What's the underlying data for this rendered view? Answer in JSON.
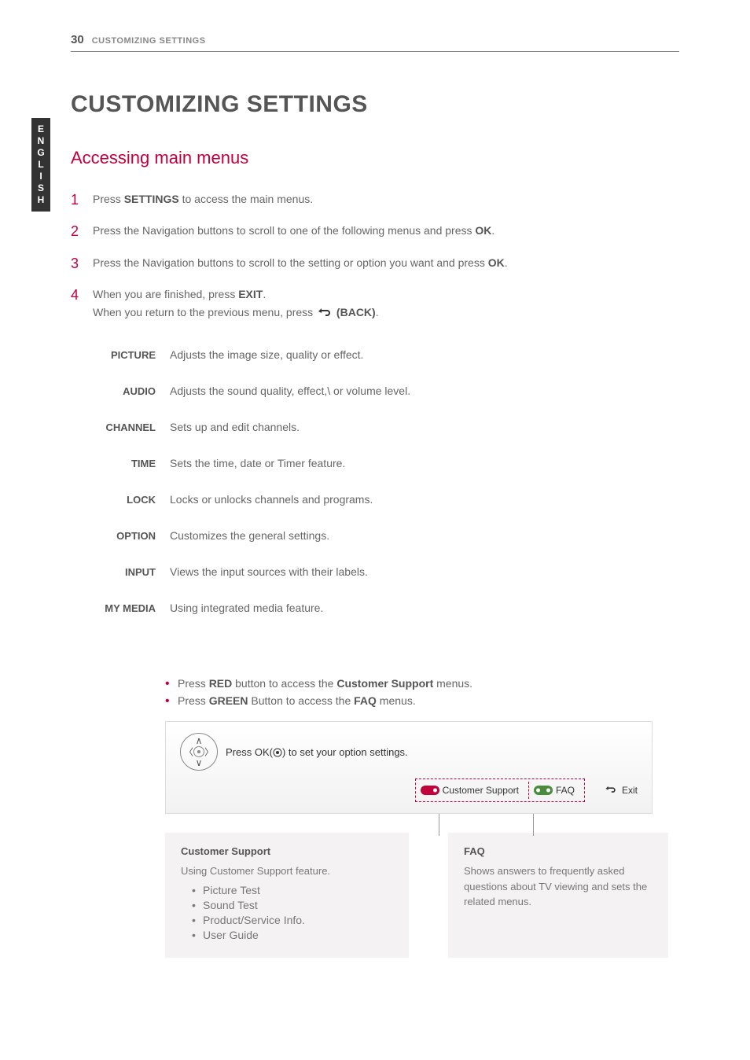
{
  "header": {
    "page_number": "30",
    "running_title": "CUSTOMIZING SETTINGS"
  },
  "language_tab": "ENGLISH",
  "title": "CUSTOMIZING SETTINGS",
  "section_title": "Accessing main menus",
  "steps": {
    "s1_a": "Press ",
    "s1_b": "SETTINGS",
    "s1_c": " to access the main menus.",
    "s2_a": "Press the Navigation buttons to scroll to one of the following menus and press ",
    "s2_b": "OK",
    "s2_c": ".",
    "s3_a": "Press the Navigation buttons to scroll to the setting or option you want and press ",
    "s3_b": "OK",
    "s3_c": ".",
    "s4_a": "When you are finished, press ",
    "s4_b": "EXIT",
    "s4_c": ".",
    "s4_line2_a": "When you return to the previous menu, press ",
    "s4_line2_b": " (BACK)",
    "s4_line2_c": "."
  },
  "menu_items": [
    {
      "label": "PICTURE",
      "desc": "Adjusts the image size, quality or effect."
    },
    {
      "label": "AUDIO",
      "desc": "Adjusts the sound quality, effect,\\ or volume level."
    },
    {
      "label": "CHANNEL",
      "desc": "Sets up and edit channels."
    },
    {
      "label": "TIME",
      "desc": "Sets the time, date or  Timer feature."
    },
    {
      "label": "LOCK",
      "desc": "Locks or unlocks channels and programs."
    },
    {
      "label": "OPTION",
      "desc": "Customizes the general settings."
    },
    {
      "label": "INPUT",
      "desc": "Views the input sources with their labels."
    },
    {
      "label": "MY MEDIA",
      "desc": "Using integrated media  feature."
    }
  ],
  "notes": {
    "n1_a": "Press ",
    "n1_b": "RED",
    "n1_c": " button to access the ",
    "n1_d": "Customer Support",
    "n1_e": " menus.",
    "n2_a": "Press ",
    "n2_b": "GREEN",
    "n2_c": " Button to access the ",
    "n2_d": "FAQ",
    "n2_e": " menus."
  },
  "screen": {
    "instruction_a": "Press OK(",
    "instruction_b": ") to set your option settings.",
    "btn_customer_support": "Customer Support",
    "btn_faq": "FAQ",
    "btn_exit": "Exit"
  },
  "callout_left": {
    "title": "Customer Support",
    "desc": "Using Customer Support feature.",
    "items": [
      "Picture Test",
      "Sound Test",
      "Product/Service Info.",
      "User Guide"
    ]
  },
  "callout_right": {
    "title": "FAQ",
    "desc": "Shows answers to frequently asked questions about TV viewing and sets the related menus."
  }
}
